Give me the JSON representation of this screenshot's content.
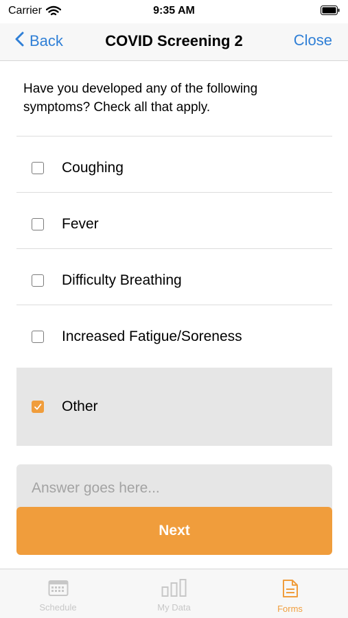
{
  "status_bar": {
    "carrier": "Carrier",
    "time": "9:35 AM"
  },
  "nav": {
    "back_label": "Back",
    "title": "COVID Screening 2",
    "close_label": "Close"
  },
  "question": "Have you developed any of the following symptoms? Check all that apply.",
  "options": [
    {
      "label": "Coughing",
      "checked": false
    },
    {
      "label": "Fever",
      "checked": false
    },
    {
      "label": "Difficulty Breathing",
      "checked": false
    },
    {
      "label": "Increased Fatigue/Soreness",
      "checked": false
    },
    {
      "label": "Other",
      "checked": true
    }
  ],
  "answer": {
    "placeholder": "Answer goes here...",
    "value": ""
  },
  "next_label": "Next",
  "tabs": [
    {
      "label": "Schedule",
      "icon": "calendar-icon",
      "active": false
    },
    {
      "label": "My Data",
      "icon": "bar-chart-icon",
      "active": false
    },
    {
      "label": "Forms",
      "icon": "document-icon",
      "active": true
    }
  ],
  "colors": {
    "accent": "#f09d3c",
    "link": "#2f7fd6",
    "selected_row": "#e6e6e6",
    "inactive_tab": "#c7c7c7"
  }
}
